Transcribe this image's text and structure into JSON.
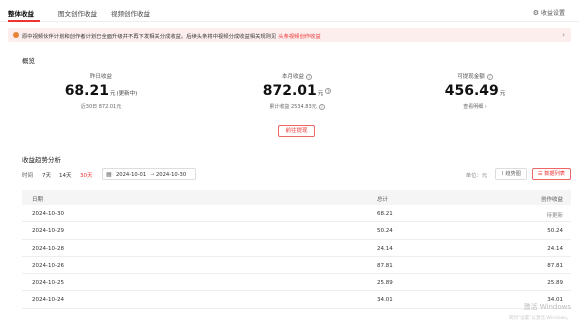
{
  "tabs": [
    {
      "label": "整体收益",
      "active": true
    },
    {
      "label": "图文创作收益",
      "active": false
    },
    {
      "label": "视频创作收益",
      "active": false
    }
  ],
  "settings_label": "收益设置",
  "notice": {
    "text": "原中视频伙伴计划和创作者计划已全面升级并不再下发相关分成收益。后续头条将中视频分成收益相关规则见",
    "link": "头条视频创作收益",
    "icon": "warning-dot-icon"
  },
  "overview": {
    "title": "概览",
    "yesterday": {
      "label": "昨日收益",
      "value": "68.21",
      "unit": "元",
      "note": "(更新中)",
      "sub": "近30日 872.01元"
    },
    "month": {
      "label": "本月收益",
      "value": "872.01",
      "unit": "元",
      "sub": "累计收益 2534.83元"
    },
    "withdrawable": {
      "label": "可提现金额",
      "value": "456.49",
      "unit": "元",
      "sub": "查看明细 ›"
    },
    "withdraw_button": "前往提现"
  },
  "trend": {
    "title": "收益趋势分析",
    "period_label": "时间",
    "periods": [
      "7天",
      "14天",
      "30天"
    ],
    "active_period": "30天",
    "date_from": "2024-10-01",
    "date_sep": "→",
    "date_to": "2024-10-30",
    "unit_label": "单位：元",
    "view_chart": "趋势图",
    "view_list": "数据列表",
    "columns": [
      "日期",
      "总计",
      "创作收益"
    ],
    "rows": [
      {
        "date": "2024-10-30",
        "total": "68.21",
        "creation": "待更新"
      },
      {
        "date": "2024-10-29",
        "total": "50.24",
        "creation": "50.24"
      },
      {
        "date": "2024-10-28",
        "total": "24.14",
        "creation": "24.14"
      },
      {
        "date": "2024-10-26",
        "total": "87.81",
        "creation": "87.81"
      },
      {
        "date": "2024-10-25",
        "total": "25.89",
        "creation": "25.89"
      },
      {
        "date": "2024-10-24",
        "total": "34.01",
        "creation": "34.01"
      }
    ]
  },
  "watermark": {
    "line1": "激活 Windows",
    "line2": "转到“设置”以激活 Windows。"
  },
  "colors": {
    "accent": "#e33333",
    "notice_bg": "#fdeeee"
  }
}
